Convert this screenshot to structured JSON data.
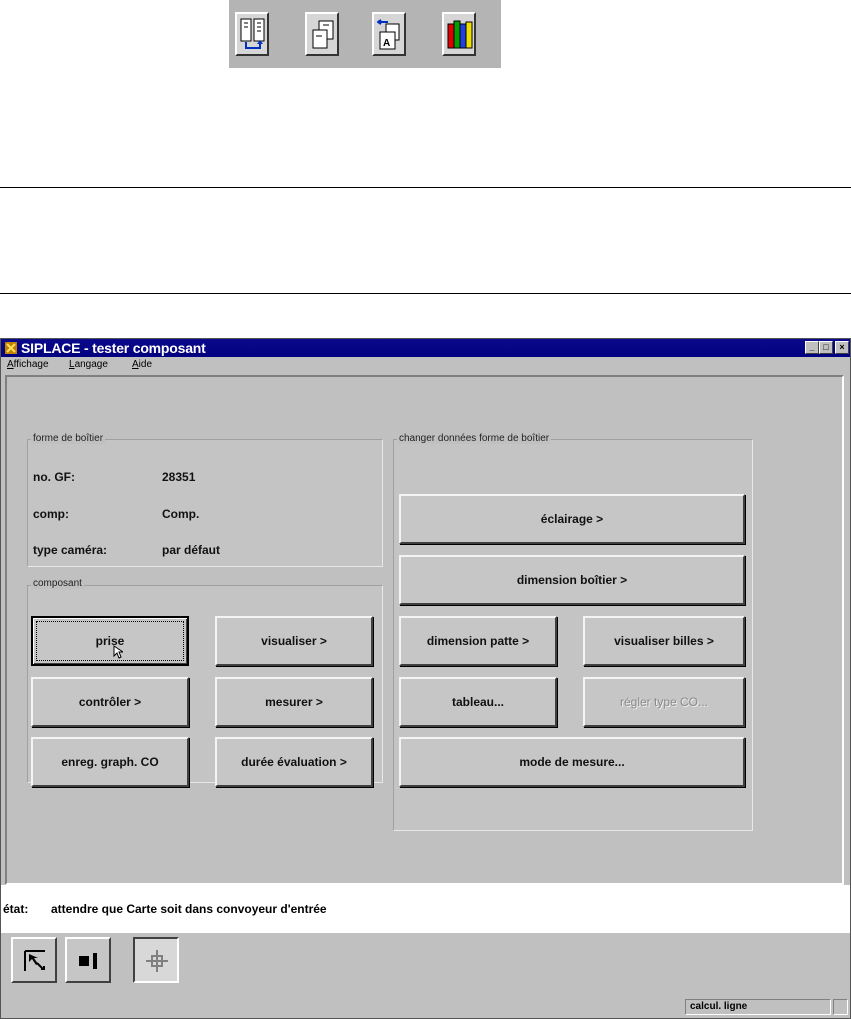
{
  "window": {
    "title": "SIPLACE - tester composant",
    "buttons": {
      "minimize": "_",
      "maximize": "□",
      "close": "×"
    }
  },
  "menu": [
    "Affichage",
    "Langage",
    "Aide"
  ],
  "package_group": {
    "title": "forme de boîtier",
    "rows": [
      {
        "label": "no. GF:",
        "value": "28351"
      },
      {
        "label": "comp:",
        "value": "Comp."
      },
      {
        "label": "type caméra:",
        "value": "par défaut"
      }
    ]
  },
  "component_group": {
    "title": "composant",
    "buttons": {
      "prise": "prise",
      "visualiser": "visualiser >",
      "controler": "contrôler >",
      "mesurer": "mesurer >",
      "enreg": "enreg. graph. CO",
      "duree": "durée évaluation >"
    }
  },
  "change_group": {
    "title": "changer données forme de boîtier",
    "buttons": {
      "eclairage": "éclairage >",
      "dimension_boitier": "dimension boîtier >",
      "dimension_patte": "dimension patte >",
      "visualiser_billes": "visualiser billes >",
      "tableau": "tableau...",
      "regler_type": "régler type CO...",
      "mode_mesure": "mode de mesure..."
    }
  },
  "status": {
    "label": "état:",
    "text": "attendre que Carte soit dans convoyeur d'entrée"
  },
  "statusbar": {
    "field": "calcul. ligne"
  },
  "icons": {
    "top_toolbar": [
      "pages-swap-icon",
      "copy-pages-icon",
      "translate-document-icon",
      "books-icon"
    ],
    "bottom_tools": [
      "cursor-select-icon",
      "component-icon",
      "crosshair-icon"
    ]
  }
}
